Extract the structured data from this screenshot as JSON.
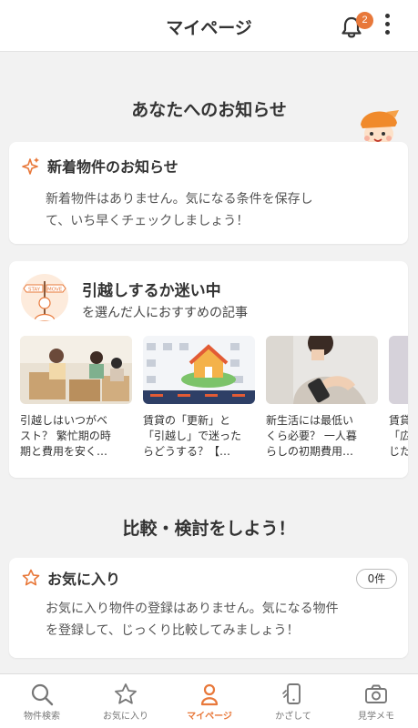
{
  "header": {
    "title": "マイページ",
    "notification_count": "2"
  },
  "notices": {
    "section_title": "あなたへのお知らせ",
    "new_listing": {
      "title": "新着物件のお知らせ",
      "body_line1": "新着物件はありません。気になる条件を保存し",
      "body_line2": "て、いち早くチェックしましょう！"
    },
    "consult": {
      "title": "引越しするか迷い中",
      "subtitle": "を選んだ人におすすめの記事",
      "sign_left": "STAY",
      "sign_right": "MOVE",
      "articles": [
        {
          "line1": "引越しはいつがベ",
          "line2": "スト？ 繁忙期の時",
          "line3": "期と費用を安く…"
        },
        {
          "line1": "賃貸の「更新」と",
          "line2": "「引越し」で迷った",
          "line3": "らどうする？【…"
        },
        {
          "line1": "新生活には最低い",
          "line2": "くら必要？ 一人暮",
          "line3": "らしの初期費用…"
        },
        {
          "line1": "賃貸",
          "line2": "「広",
          "line3": "じた"
        }
      ]
    }
  },
  "compare": {
    "section_title": "比較・検討をしよう！",
    "favorites": {
      "title": "お気に入り",
      "count": "0件",
      "body_line1": "お気に入り物件の登録はありません。気になる物件",
      "body_line2": "を登録して、じっくり比較してみましょう！"
    }
  },
  "tabbar": {
    "tabs": [
      {
        "label": "物件検索",
        "icon": "search-icon"
      },
      {
        "label": "お気に入り",
        "icon": "star-icon"
      },
      {
        "label": "マイページ",
        "icon": "person-icon",
        "active": true
      },
      {
        "label": "かざして",
        "icon": "phone-scan-icon"
      },
      {
        "label": "見学メモ",
        "icon": "camera-icon"
      }
    ]
  },
  "colors": {
    "accent": "#e8783a",
    "background": "#f2f2f2",
    "card": "#ffffff"
  }
}
